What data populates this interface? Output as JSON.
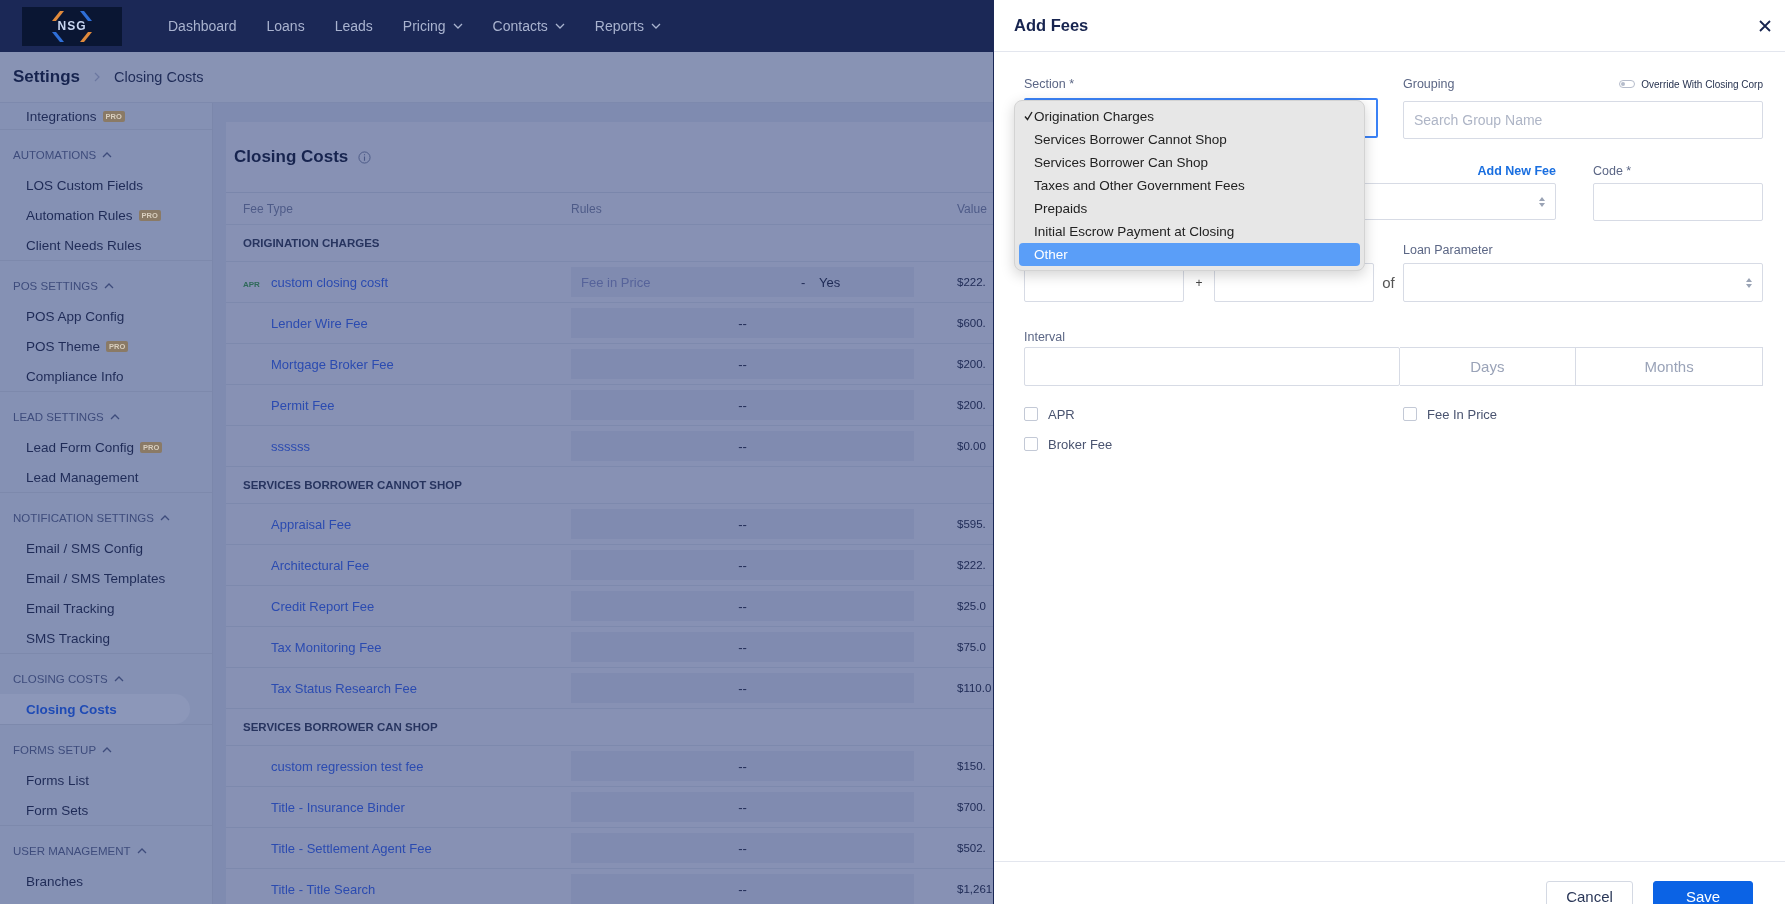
{
  "nav": {
    "logo": "NSG",
    "items": [
      {
        "label": "Dashboard",
        "dropdown": false
      },
      {
        "label": "Loans",
        "dropdown": false
      },
      {
        "label": "Leads",
        "dropdown": false
      },
      {
        "label": "Pricing",
        "dropdown": true
      },
      {
        "label": "Contacts",
        "dropdown": true
      },
      {
        "label": "Reports",
        "dropdown": true
      }
    ]
  },
  "breadcrumb": {
    "root": "Settings",
    "current": "Closing Costs"
  },
  "sidebar": {
    "items": [
      {
        "label": "Integrations",
        "pro": "PRO",
        "selected": false
      }
    ],
    "sections": [
      {
        "title": "AUTOMATIONS",
        "expanded": true,
        "items": [
          {
            "label": "LOS Custom Fields",
            "pro": false,
            "selected": false
          },
          {
            "label": "Automation Rules",
            "pro": "PRO",
            "selected": false
          },
          {
            "label": "Client Needs Rules",
            "pro": false,
            "selected": false
          }
        ]
      },
      {
        "title": "POS SETTINGS",
        "expanded": true,
        "items": [
          {
            "label": "POS App Config",
            "pro": false,
            "selected": false
          },
          {
            "label": "POS Theme",
            "pro": "PRO",
            "selected": false
          },
          {
            "label": "Compliance Info",
            "pro": false,
            "selected": false
          }
        ]
      },
      {
        "title": "LEAD SETTINGS",
        "expanded": true,
        "items": [
          {
            "label": "Lead Form Config",
            "pro": "PRO",
            "selected": false
          },
          {
            "label": "Lead Management",
            "pro": false,
            "selected": false
          }
        ]
      },
      {
        "title": "NOTIFICATION SETTINGS",
        "expanded": true,
        "items": [
          {
            "label": "Email / SMS Config",
            "pro": false,
            "selected": false
          },
          {
            "label": "Email / SMS Templates",
            "pro": false,
            "selected": false
          },
          {
            "label": "Email Tracking",
            "pro": false,
            "selected": false
          },
          {
            "label": "SMS Tracking",
            "pro": false,
            "selected": false
          }
        ]
      },
      {
        "title": "CLOSING COSTS",
        "expanded": true,
        "items": [
          {
            "label": "Closing Costs",
            "pro": false,
            "selected": true
          }
        ]
      },
      {
        "title": "FORMS SETUP",
        "expanded": true,
        "items": [
          {
            "label": "Forms List",
            "pro": false,
            "selected": false
          },
          {
            "label": "Form Sets",
            "pro": false,
            "selected": false
          }
        ]
      },
      {
        "title": "USER MANAGEMENT",
        "expanded": true,
        "items": [
          {
            "label": "Branches",
            "pro": false,
            "selected": false
          }
        ]
      }
    ]
  },
  "page": {
    "title": "Closing Costs",
    "columns": [
      "Fee Type",
      "Rules",
      "Value"
    ],
    "groups": [
      {
        "title": "ORIGINATION CHARGES",
        "rows": [
          {
            "tag": "APR",
            "name": "custom closing cosft",
            "rules": {
              "kind": "condition",
              "label": "Fee in Price",
              "separator": "-",
              "value": "Yes"
            },
            "value": "$222."
          },
          {
            "name": "Lender Wire Fee",
            "rules": {
              "kind": "none",
              "text": "--"
            },
            "value": "$600."
          },
          {
            "name": "Mortgage Broker Fee",
            "rules": {
              "kind": "none",
              "text": "--"
            },
            "value": "$200."
          },
          {
            "name": "Permit Fee",
            "rules": {
              "kind": "none",
              "text": "--"
            },
            "value": "$200."
          },
          {
            "name": "ssssss",
            "rules": {
              "kind": "none",
              "text": "--"
            },
            "value": "$0.00"
          }
        ]
      },
      {
        "title": "SERVICES BORROWER CANNOT SHOP",
        "rows": [
          {
            "name": "Appraisal Fee",
            "rules": {
              "kind": "none",
              "text": "--"
            },
            "value": "$595."
          },
          {
            "name": "Architectural Fee",
            "rules": {
              "kind": "none",
              "text": "--"
            },
            "value": "$222."
          },
          {
            "name": "Credit Report Fee",
            "rules": {
              "kind": "none",
              "text": "--"
            },
            "value": "$25.0"
          },
          {
            "name": "Tax Monitoring Fee",
            "rules": {
              "kind": "none",
              "text": "--"
            },
            "value": "$75.0"
          },
          {
            "name": "Tax Status Research Fee",
            "rules": {
              "kind": "none",
              "text": "--"
            },
            "value": "$110.0"
          }
        ]
      },
      {
        "title": "SERVICES BORROWER CAN SHOP",
        "rows": [
          {
            "name": "custom regression test fee",
            "rules": {
              "kind": "none",
              "text": "--"
            },
            "value": "$150."
          },
          {
            "name": "Title - Insurance Binder",
            "rules": {
              "kind": "none",
              "text": "--"
            },
            "value": "$700."
          },
          {
            "name": "Title - Settlement Agent Fee",
            "rules": {
              "kind": "none",
              "text": "--"
            },
            "value": "$502."
          },
          {
            "name": "Title - Title Search",
            "rules": {
              "kind": "none",
              "text": "--"
            },
            "value": "$1,261"
          }
        ]
      }
    ]
  },
  "drawer": {
    "title": "Add Fees",
    "section": {
      "label": "Section *",
      "focused": true
    },
    "grouping": {
      "label": "Grouping",
      "placeholder": "Search Group Name"
    },
    "override": {
      "label": "Override With Closing Corp",
      "on": false
    },
    "add_new_fee": "Add New Fee",
    "code": {
      "label": "Code *"
    },
    "plus": "+",
    "of": "of",
    "loan_parameter": {
      "label": "Loan Parameter"
    },
    "interval": {
      "label": "Interval",
      "units": [
        "Days",
        "Months"
      ]
    },
    "checkboxes": [
      {
        "label": "APR",
        "checked": false
      },
      {
        "label": "Fee In Price",
        "checked": false
      },
      {
        "label": "Broker Fee",
        "checked": false
      }
    ],
    "buttons": [
      {
        "label": "Cancel",
        "kind": "secondary"
      },
      {
        "label": "Save",
        "kind": "primary"
      }
    ],
    "dropdown": [
      {
        "label": "Origination Charges",
        "checked": true,
        "selected": false
      },
      {
        "label": "Services Borrower Cannot Shop",
        "checked": false,
        "selected": false
      },
      {
        "label": "Services Borrower Can Shop",
        "checked": false,
        "selected": false
      },
      {
        "label": "Taxes and Other Government Fees",
        "checked": false,
        "selected": false
      },
      {
        "label": "Prepaids",
        "checked": false,
        "selected": false
      },
      {
        "label": "Initial Escrow Payment at Closing",
        "checked": false,
        "selected": false
      },
      {
        "label": "Other",
        "checked": false,
        "selected": true
      }
    ]
  }
}
